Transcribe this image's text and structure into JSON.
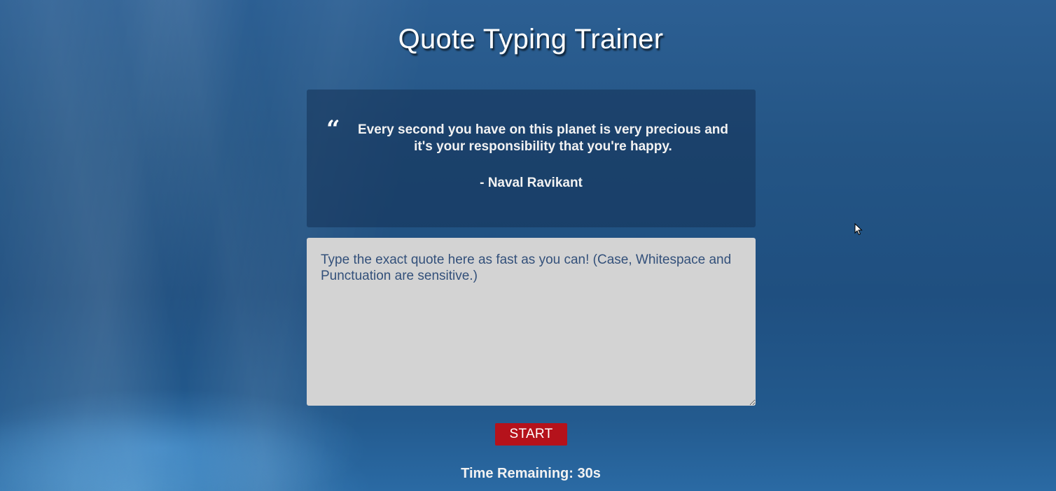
{
  "page": {
    "title": "Quote Typing Trainer"
  },
  "quote": {
    "open_mark": "“",
    "text": "Every second you have on this planet is very precious and it's your responsibility that you're happy.",
    "author": "- Naval Ravikant"
  },
  "input": {
    "placeholder": "Type the exact quote here as fast as you can! (Case, Whitespace and Punctuation are sensitive.)",
    "value": ""
  },
  "controls": {
    "start_label": "START"
  },
  "timer": {
    "text": "Time Remaining: 30s"
  },
  "colors": {
    "start_button": "#b5121b",
    "input_background": "#d3d3d3",
    "quote_card": "#1e3f66"
  },
  "icons": {
    "cursor": "mouse-pointer-icon"
  }
}
